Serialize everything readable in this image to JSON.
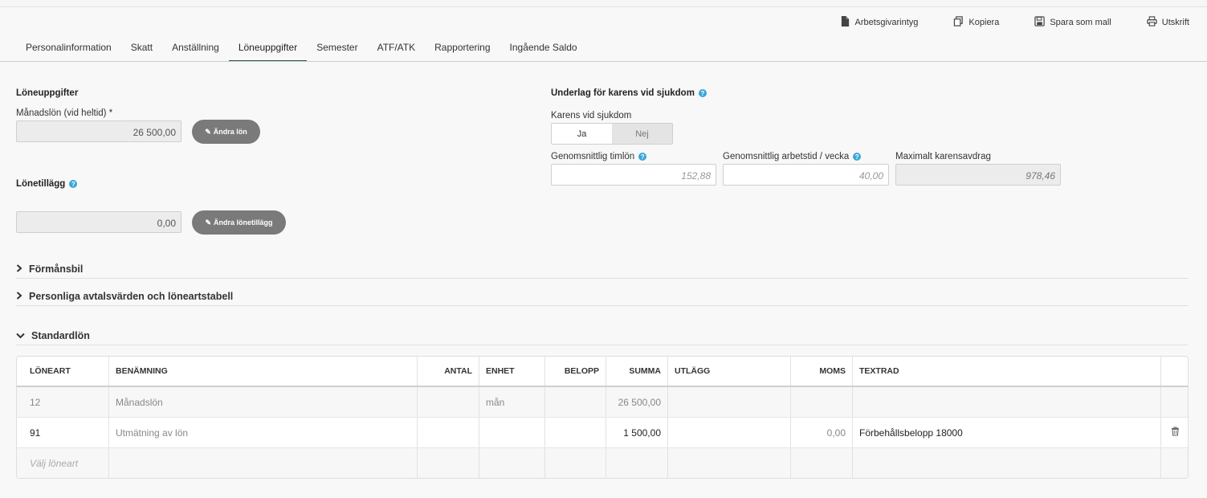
{
  "actions": [
    {
      "label": "Arbetsgivarintyg",
      "icon": "document-icon"
    },
    {
      "label": "Kopiera",
      "icon": "copy-icon"
    },
    {
      "label": "Spara som mall",
      "icon": "save-icon"
    },
    {
      "label": "Utskrift",
      "icon": "print-icon"
    }
  ],
  "tabs": [
    {
      "label": "Personalinformation"
    },
    {
      "label": "Skatt"
    },
    {
      "label": "Anställning"
    },
    {
      "label": "Löneuppgifter"
    },
    {
      "label": "Semester"
    },
    {
      "label": "ATF/ATK"
    },
    {
      "label": "Rapportering"
    },
    {
      "label": "Ingående Saldo"
    }
  ],
  "active_tab": "Löneuppgifter",
  "salary": {
    "title": "Löneuppgifter",
    "monthly_label": "Månadslön (vid heltid) *",
    "monthly_value": "26 500,00",
    "change_button": "Ändra lön"
  },
  "supplement": {
    "title": "Lönetillägg",
    "value": "0,00",
    "change_button": "Ändra lönetillägg"
  },
  "karens": {
    "title": "Underlag för karens vid sjukdom",
    "toggle_label": "Karens vid sjukdom",
    "yes": "Ja",
    "no": "Nej",
    "selected": "Ja",
    "avg_hourly_label": "Genomsnittlig timlön",
    "avg_hourly_value": "152,88",
    "avg_hours_label": "Genomsnittlig arbetstid / vecka",
    "avg_hours_value": "40,00",
    "max_deduction_label": "Maximalt karensavdrag",
    "max_deduction_value": "978,46"
  },
  "sections": {
    "formansbil": "Förmånsbil",
    "personliga": "Personliga avtalsvärden och löneartstabell",
    "standardlon": "Standardlön"
  },
  "table": {
    "headers": [
      "LÖNEART",
      "BENÄMNING",
      "ANTAL",
      "ENHET",
      "BELOPP",
      "SUMMA",
      "UTLÄGG",
      "MOMS",
      "TEXTRAD"
    ],
    "rows": [
      {
        "loneart": "12",
        "benamning": "Månadslön",
        "antal": "",
        "enhet": "mån",
        "belopp": "",
        "summa": "26 500,00",
        "utlagg": "",
        "moms": "",
        "textrad": ""
      },
      {
        "loneart": "91",
        "benamning": "Utmätning av lön",
        "antal": "",
        "enhet": "",
        "belopp": "",
        "summa": "1 500,00",
        "utlagg": "",
        "moms": "0,00",
        "textrad": "Förbehållsbelopp 18000"
      }
    ],
    "new_row_placeholder": "Välj löneart"
  },
  "colors": {
    "accent": "#1f5a39",
    "help": "#3aa6d8",
    "button": "#7a7a7a"
  }
}
